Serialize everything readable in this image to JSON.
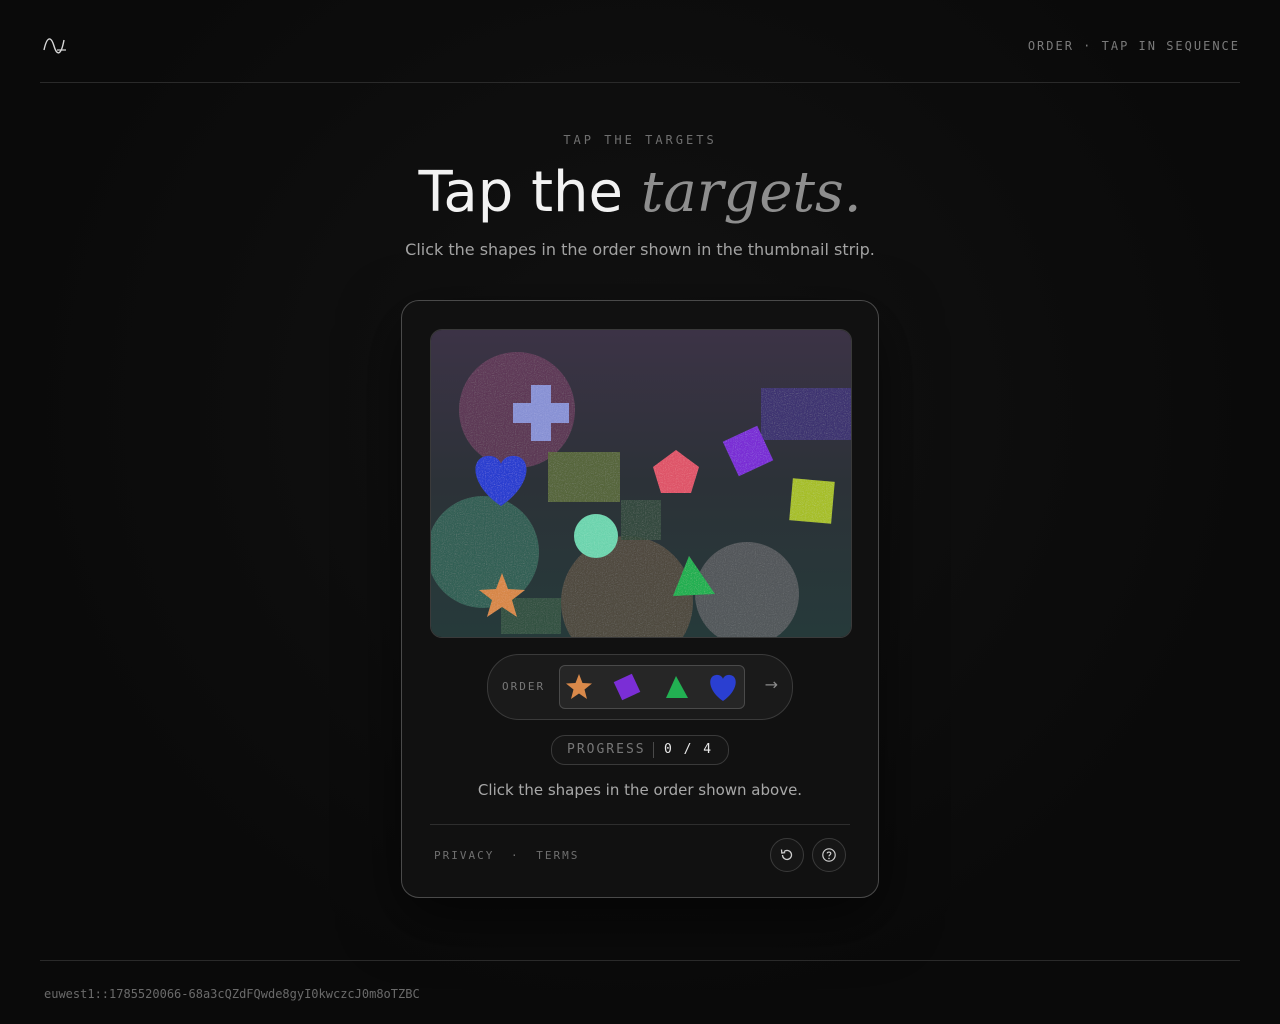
{
  "header": {
    "logo_icon": "wave-logo-icon",
    "tag": "ORDER · TAP IN SEQUENCE"
  },
  "hero": {
    "eyebrow": "TAP THE TARGETS",
    "title_main": "Tap the",
    "title_emphasis": "targets.",
    "subtitle": "Click the shapes in the order shown in the thumbnail strip."
  },
  "challenge": {
    "canvas_shapes": [
      {
        "name": "plus-shape",
        "color": "#8a93d6"
      },
      {
        "name": "heart-shape",
        "color": "#2a3fd1"
      },
      {
        "name": "square-shape",
        "color": "#5a6a3a"
      },
      {
        "name": "pentagon-shape",
        "color": "#e0566a"
      },
      {
        "name": "diamond-shape",
        "color": "#7b2ed6"
      },
      {
        "name": "square-shape",
        "color": "#a8c02a"
      },
      {
        "name": "circle-shape",
        "color": "#6fd6b0"
      },
      {
        "name": "triangle-shape",
        "color": "#22b052"
      },
      {
        "name": "star-shape",
        "color": "#d9894a"
      },
      {
        "name": "rectangle-shape",
        "color": "#3a2a7a"
      }
    ],
    "order_label": "ORDER",
    "order_sequence": [
      {
        "icon": "star-icon",
        "color": "#d9894a"
      },
      {
        "icon": "diamond-icon",
        "color": "#7b2ed6"
      },
      {
        "icon": "triangle-icon",
        "color": "#22b052"
      },
      {
        "icon": "heart-icon",
        "color": "#2a3fd1"
      }
    ],
    "next_arrow": "→",
    "progress_label": "PROGRESS",
    "progress_value": "0 / 4",
    "instruction": "Click the shapes in the order shown above.",
    "links": {
      "privacy": "PRIVACY",
      "separator": "·",
      "terms": "TERMS"
    },
    "buttons": {
      "refresh_icon": "refresh-icon",
      "help_icon": "help-icon"
    }
  },
  "footer": {
    "session_id": "euwest1::1785520066-68a3cQZdFQwde8gyI0kwczcJ0m8oTZBC"
  }
}
